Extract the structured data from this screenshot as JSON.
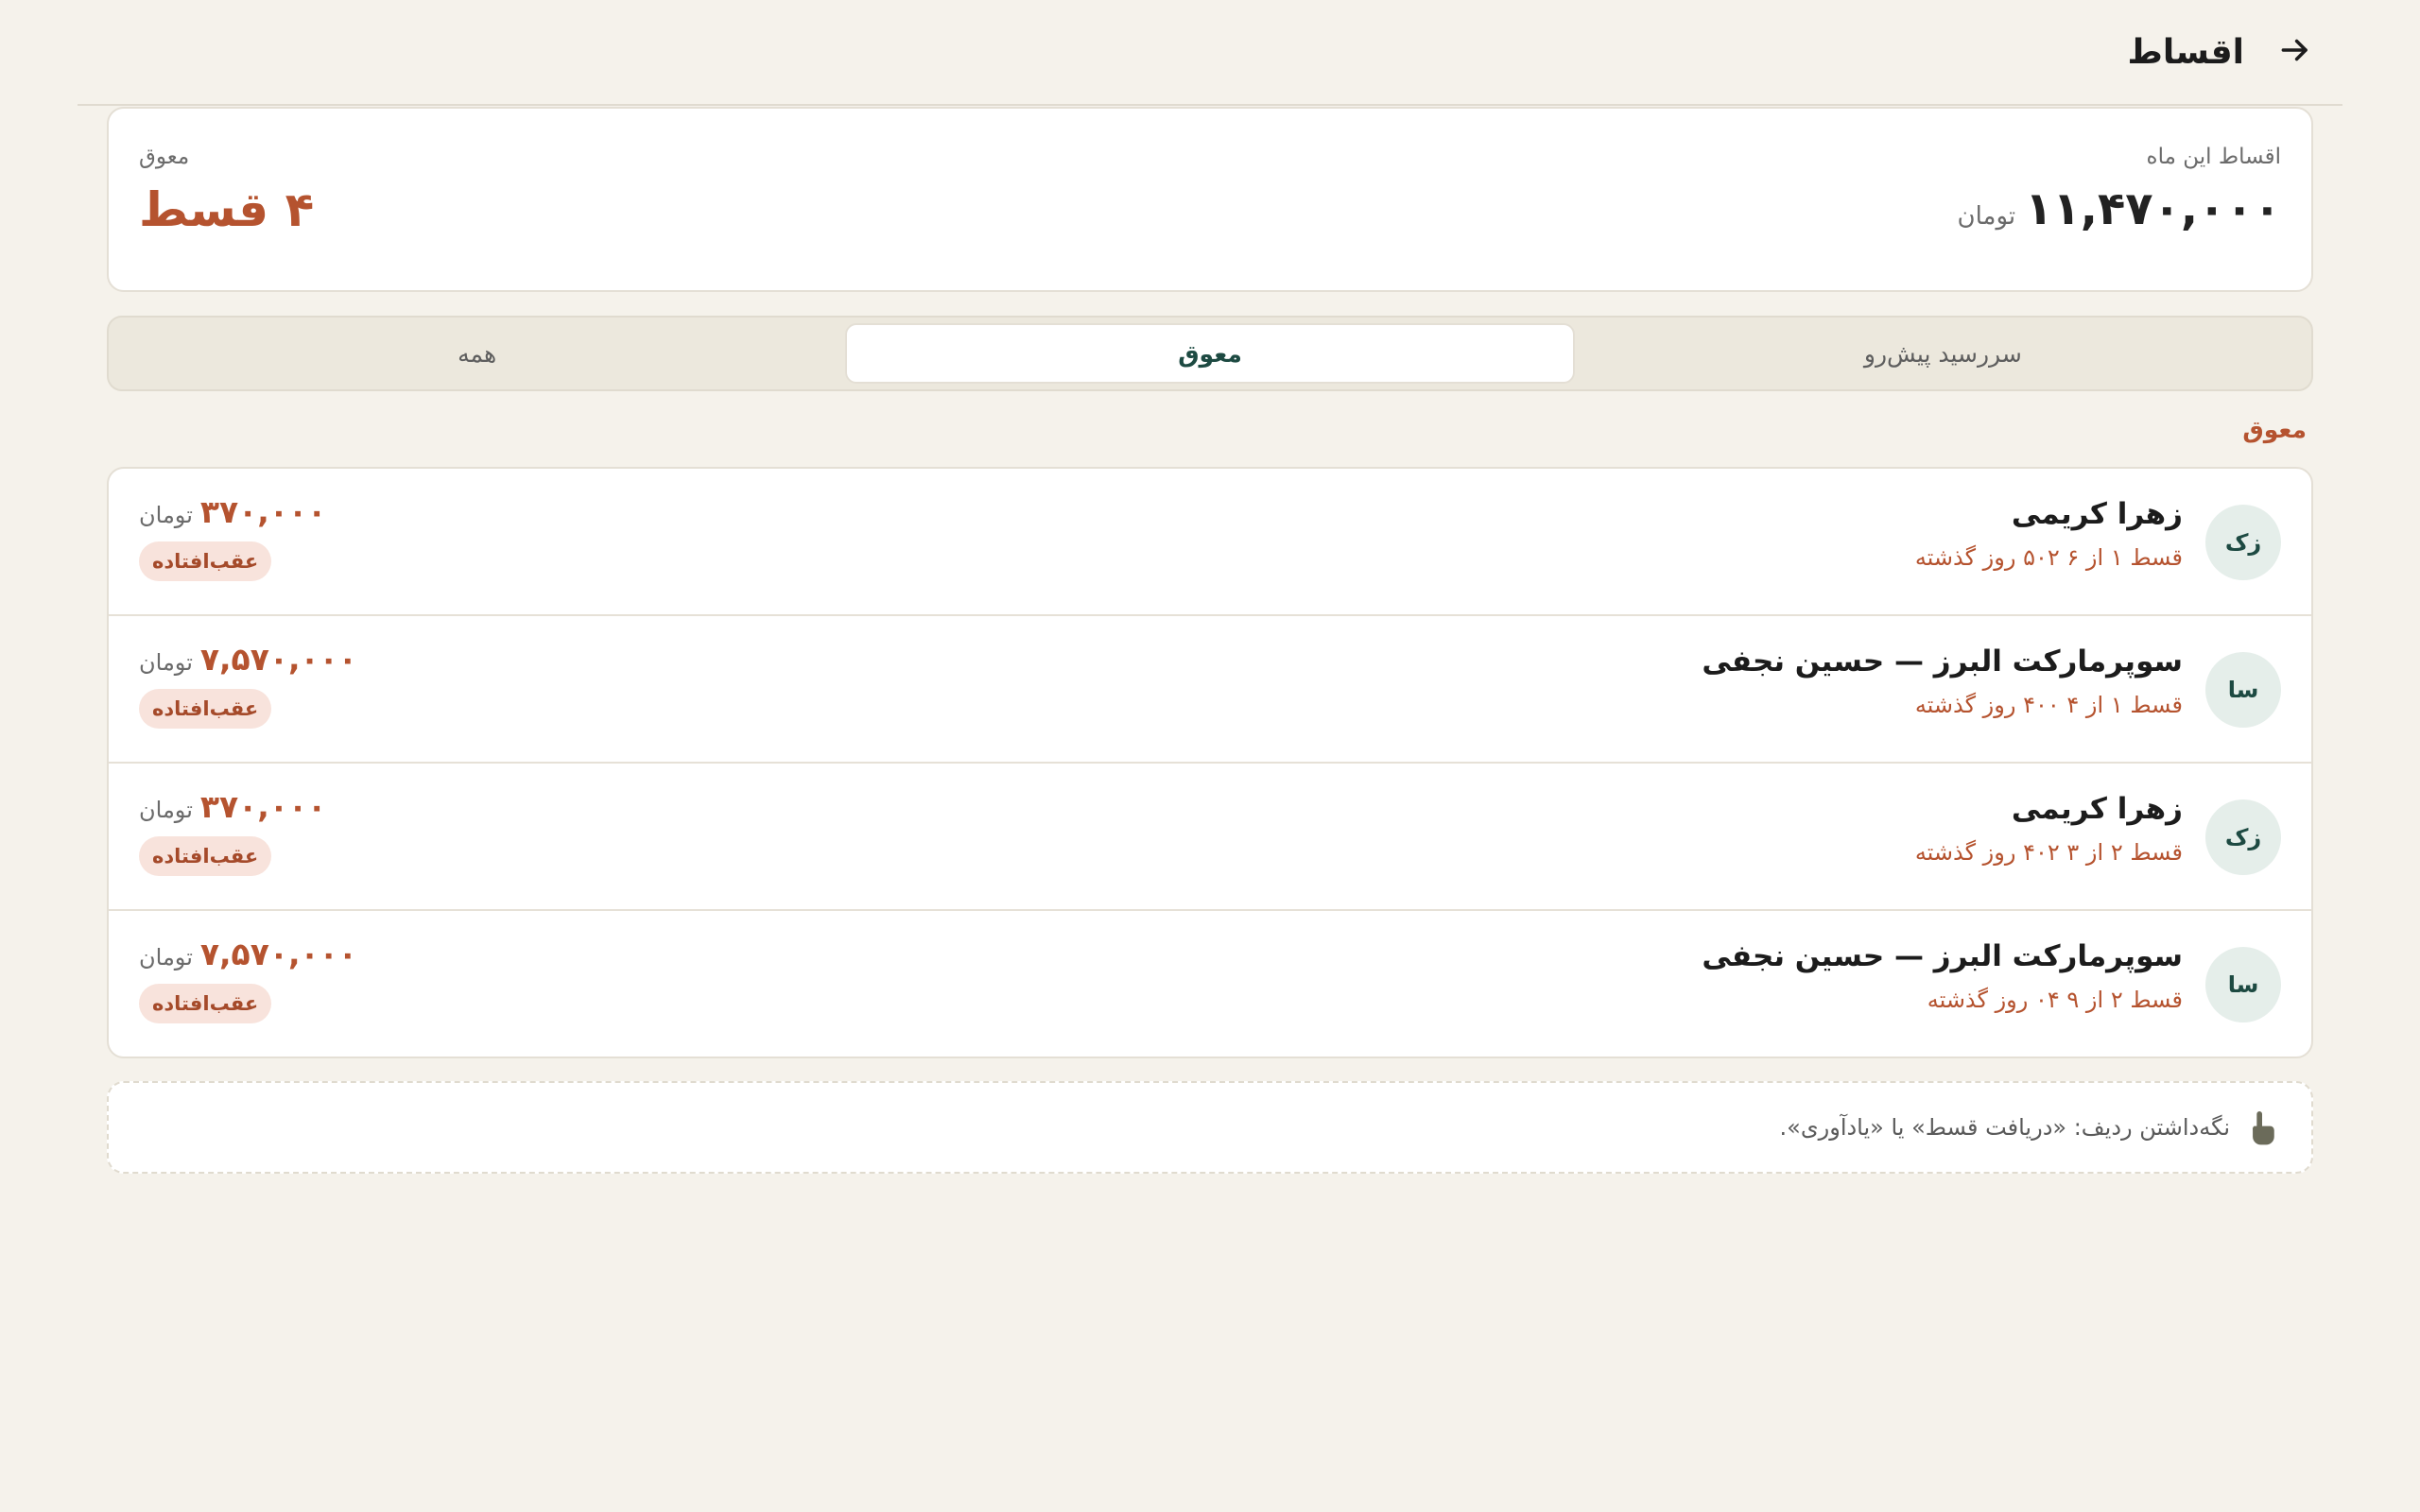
{
  "header": {
    "title": "اقساط",
    "back_icon": "arrow-right-icon"
  },
  "summary": {
    "month_label": "اقساط این ماه",
    "month_total": "۱۱,۴۷۰,۰۰۰",
    "currency": "تومان",
    "overdue_label": "معوق",
    "overdue_count": "۴ قسط"
  },
  "tabs": [
    {
      "label": "سررسید پیش‌رو",
      "active": false
    },
    {
      "label": "معوق",
      "active": true
    },
    {
      "label": "همه",
      "active": false
    }
  ],
  "section": {
    "title": "معوق"
  },
  "installments": [
    {
      "initials": "زک",
      "name": "زهرا کریمی",
      "info": "قسط ۱ از ۶ ۵۰۲ روز گذشته",
      "amount": "۳۷۰,۰۰۰",
      "currency": "تومان",
      "status": "عقب‌افتاده"
    },
    {
      "initials": "سا",
      "name": "سوپرمارکت البرز — حسین نجفی",
      "info": "قسط ۱ از ۴ ۴۰۰ روز گذشته",
      "amount": "۷,۵۷۰,۰۰۰",
      "currency": "تومان",
      "status": "عقب‌افتاده"
    },
    {
      "initials": "زک",
      "name": "زهرا کریمی",
      "info": "قسط ۲ از ۳ ۴۰۲ روز گذشته",
      "amount": "۳۷۰,۰۰۰",
      "currency": "تومان",
      "status": "عقب‌افتاده"
    },
    {
      "initials": "سا",
      "name": "سوپرمارکت البرز — حسین نجفی",
      "info": "قسط ۲ از ۹ ۰۴ روز گذشته",
      "amount": "۷,۵۷۰,۰۰۰",
      "currency": "تومان",
      "status": "عقب‌افتاده"
    }
  ],
  "hint": {
    "text": "نگه‌داشتن ردیف: «دریافت قسط» یا «یادآوری».",
    "icon": "tap-hold-icon"
  },
  "colors": {
    "background": "#f5f2eb",
    "accent_overdue": "#b5532f",
    "accent_primary": "#1d4a42",
    "badge_bg": "#f8e3dc"
  }
}
